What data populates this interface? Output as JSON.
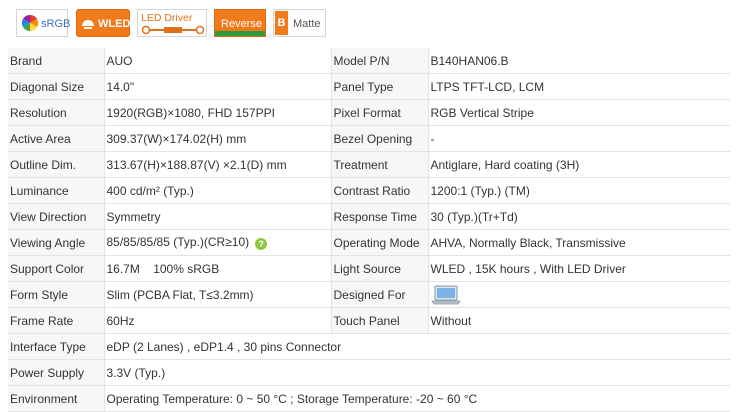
{
  "badges": {
    "srgb": "sRGB",
    "wled": "WLED",
    "led_driver": "LED Driver",
    "reverse": "Reverse",
    "matte_tag": "B",
    "matte": "Matte"
  },
  "specs": {
    "brand_label": "Brand",
    "brand": "AUO",
    "model_label": "Model P/N",
    "model": "B140HAN06.B",
    "diag_label": "Diagonal Size",
    "diag": "14.0\"",
    "panel_label": "Panel Type",
    "panel": "LTPS TFT-LCD, LCM",
    "res_label": "Resolution",
    "res": "1920(RGB)×1080, FHD  157PPI",
    "pixel_label": "Pixel Format",
    "pixel": "RGB Vertical Stripe",
    "active_label": "Active Area",
    "active": "309.37(W)×174.02(H) mm",
    "bezel_label": "Bezel Opening",
    "bezel": "-",
    "outline_label": "Outline Dim.",
    "outline": "313.67(H)×188.87(V) ×2.1(D) mm",
    "treat_label": "Treatment",
    "treat": "Antiglare, Hard coating (3H)",
    "lum_label": "Luminance",
    "lum": "400 cd/m² (Typ.)",
    "contrast_label": "Contrast Ratio",
    "contrast": "1200:1 (Typ.) (TM)",
    "viewdir_label": "View Direction",
    "viewdir": "Symmetry",
    "resp_label": "Response Time",
    "resp": "30 (Typ.)(Tr+Td)",
    "angle_label": "Viewing Angle",
    "angle": "85/85/85/85 (Typ.)(CR≥10)",
    "angle_help": "?",
    "opmode_label": "Operating Mode",
    "opmode": "AHVA, Normally Black, Transmissive",
    "color_label": "Support Color",
    "color": "16.7M    100% sRGB",
    "light_label": "Light Source",
    "light": "WLED , 15K hours , With LED Driver",
    "form_label": "Form Style",
    "form": "Slim (PCBA Flat, T≤3.2mm)",
    "design_label": "Designed For",
    "design_icon": "laptop-icon",
    "frame_label": "Frame Rate",
    "frame": "60Hz",
    "touch_label": "Touch Panel",
    "touch": "Without",
    "iface_label": "Interface Type",
    "iface": "eDP (2 Lanes) , eDP1.4 , 30 pins Connector",
    "power_label": "Power Supply",
    "power": "3.3V (Typ.)",
    "env_label": "Environment",
    "env": "Operating Temperature: 0 ~ 50 °C ; Storage Temperature: -20 ~ 60 °C"
  },
  "colors": {
    "accent": "#f07a1c",
    "green": "#2f9a3a",
    "help": "#8dc63f",
    "label_bg": "#f7f7f7",
    "border": "#e3e3e3"
  }
}
